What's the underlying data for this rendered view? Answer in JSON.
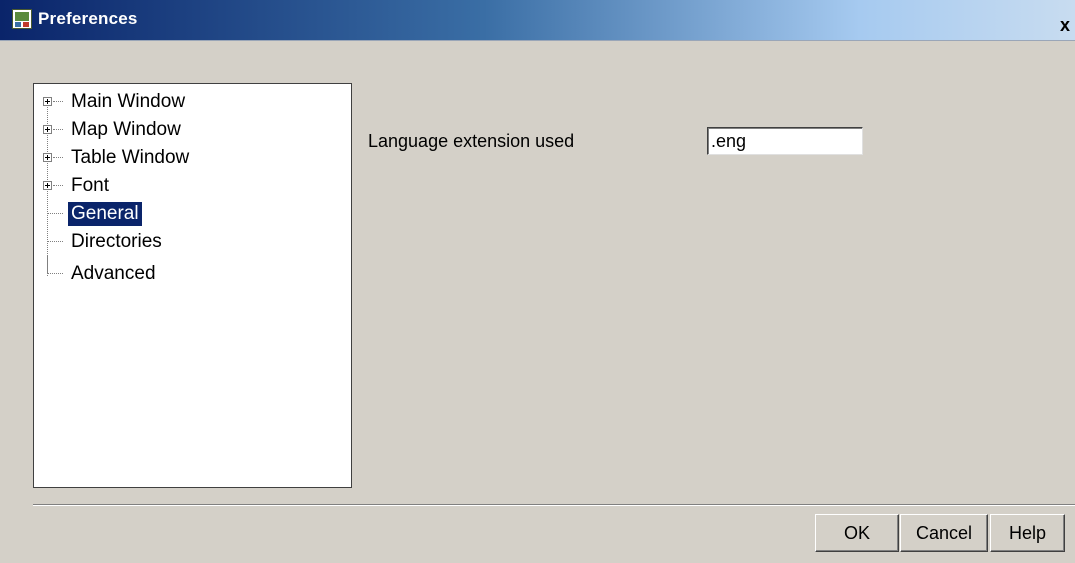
{
  "window": {
    "title": "Preferences",
    "close_label": "x",
    "app_icon": "mapping-app-icon"
  },
  "tree": {
    "items": [
      {
        "label": "Main Window",
        "expandable": true,
        "selected": false
      },
      {
        "label": "Map Window",
        "expandable": true,
        "selected": false
      },
      {
        "label": "Table Window",
        "expandable": true,
        "selected": false
      },
      {
        "label": "Font",
        "expandable": true,
        "selected": false
      },
      {
        "label": "General",
        "expandable": false,
        "selected": true
      },
      {
        "label": "Directories",
        "expandable": false,
        "selected": false
      },
      {
        "label": "Advanced",
        "expandable": false,
        "selected": false
      }
    ]
  },
  "general": {
    "language_label": "Language extension used",
    "language_value": ".eng"
  },
  "buttons": {
    "ok": "OK",
    "cancel": "Cancel",
    "help": "Help"
  },
  "colors": {
    "selection": "#0a246a",
    "dialog_bg": "#d4d0c8",
    "title_gradient_start": "#0a246a",
    "title_gradient_end": "#a6caf0"
  }
}
